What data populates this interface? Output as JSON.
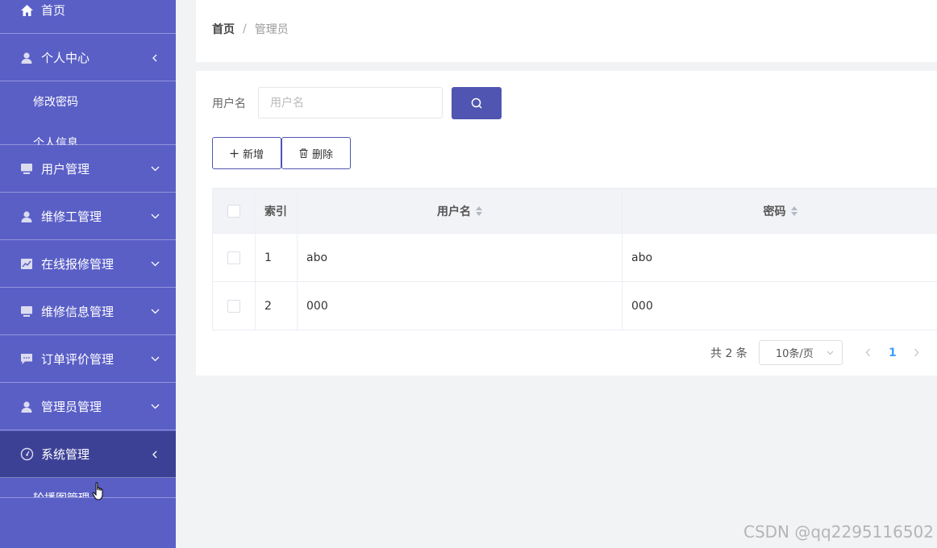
{
  "sidebar": {
    "home": "首页",
    "personal_center": {
      "label": "个人中心",
      "children": [
        "修改密码",
        "个人信息"
      ]
    },
    "menus": [
      {
        "label": "用户管理",
        "icon": "monitor-icon"
      },
      {
        "label": "维修工管理",
        "icon": "user-icon"
      },
      {
        "label": "在线报修管理",
        "icon": "chart-icon"
      },
      {
        "label": "维修信息管理",
        "icon": "monitor-icon"
      },
      {
        "label": "订单评价管理",
        "icon": "chat-icon"
      },
      {
        "label": "管理员管理",
        "icon": "user-icon"
      }
    ],
    "system": {
      "label": "系统管理",
      "children": [
        "轮播图管理"
      ]
    }
  },
  "breadcrumb": {
    "home": "首页",
    "separator": "/",
    "current": "管理员"
  },
  "search": {
    "label": "用户名",
    "placeholder": "用户名"
  },
  "toolbar": {
    "add_label": "新增",
    "delete_label": "删除"
  },
  "table": {
    "headers": {
      "index": "索引",
      "username": "用户名",
      "password": "密码"
    },
    "rows": [
      {
        "index": "1",
        "username": "abo",
        "password": "abo"
      },
      {
        "index": "2",
        "username": "000",
        "password": "000"
      }
    ]
  },
  "pagination": {
    "total": "共 2 条",
    "page_size": "10条/页",
    "current_page": "1"
  },
  "watermark": "CSDN @qq2295116502",
  "colors": {
    "sidebar": "#5a5fc6",
    "sidebar_active": "#3d4196",
    "primary": "#4f55b0",
    "page_active": "#409eff"
  }
}
